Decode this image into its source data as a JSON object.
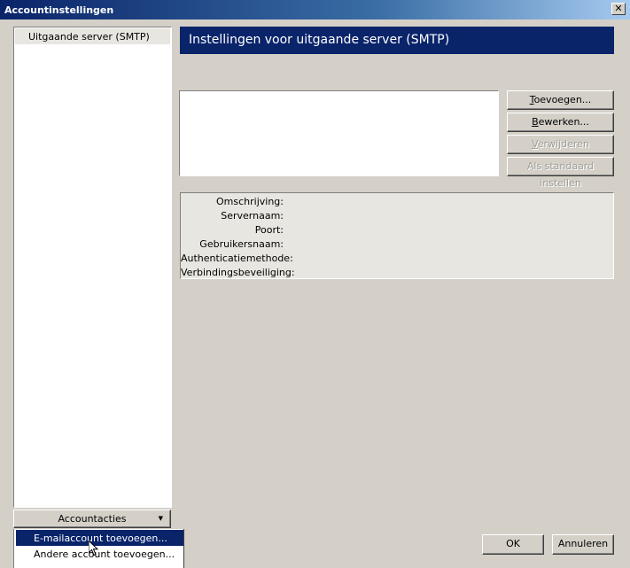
{
  "window": {
    "title": "Accountinstellingen",
    "close_glyph": "✕"
  },
  "sidebar": {
    "tree_items": [
      {
        "label": "Uitgaande server (SMTP)"
      }
    ],
    "account_actions_label": "Accountacties",
    "account_actions_arrow": "▼"
  },
  "main": {
    "header": "Instellingen voor uitgaande server (SMTP)",
    "buttons": {
      "add": {
        "accel": "T",
        "rest": "oevoegen..."
      },
      "edit": {
        "accel": "B",
        "rest": "ewerken..."
      },
      "remove": {
        "accel": "V",
        "rest": "erwijderen"
      },
      "set_default": {
        "label": "Als standaard instellen"
      }
    },
    "details": [
      "Omschrijving:",
      "Servernaam:",
      "Poort:",
      "Gebruikersnaam:",
      "Authenticatiemethode:",
      "Verbindingsbeveiliging:"
    ]
  },
  "footer": {
    "ok_label": "OK",
    "cancel_label": "Annuleren"
  },
  "popup_menu": {
    "items": [
      {
        "label": "E-mailaccount toevoegen...",
        "selected": true
      },
      {
        "label": "Andere account toevoegen...",
        "selected": false
      }
    ]
  },
  "colors": {
    "dialog_bg": "#d4d0c8",
    "title_active": "#0a246a",
    "selection": "#0a246a",
    "list_bg": "#ffffff",
    "details_bg": "#e8e6e0"
  },
  "icons": {
    "cursor": "mouse-pointer-icon",
    "dropdown": "triangle-down-icon"
  }
}
